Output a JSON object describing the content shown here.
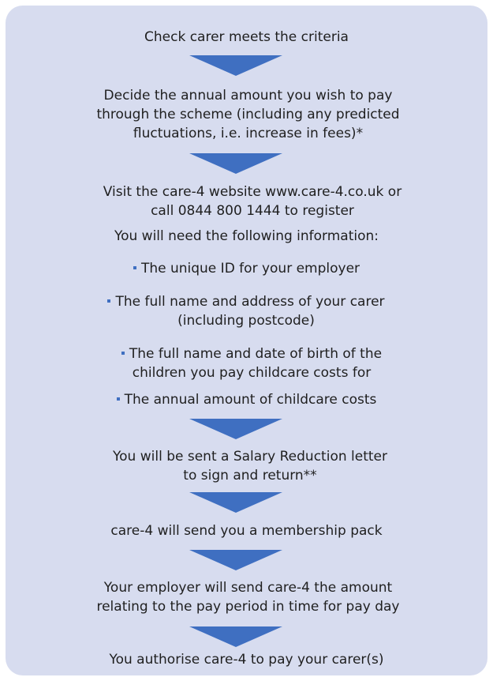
{
  "steps": [
    {
      "text": "Check carer meets the criteria"
    },
    {
      "text": "Decide the annual amount you wish to pay through the scheme (including any predicted fluctuations, i.e. increase in fees)*"
    },
    {
      "text": "Visit the care-4 website www.care-4.co.uk or call 0844 800 1444 to register"
    },
    {
      "text": "You will be sent a Salary Reduction letter to sign and return**"
    },
    {
      "text": "care-4 will send you a membership pack"
    },
    {
      "text": "Your employer will send care-4 the amount relating to the pay period in time for pay day"
    },
    {
      "text": "You authorise care-4 to pay your carer(s)"
    }
  ],
  "info": {
    "heading": "You will need the following information:",
    "items": [
      "The unique ID for your employer",
      "The full name and address of your carer (including postcode)",
      "The full name and date of birth of the children you pay childcare costs for",
      "The annual amount of childcare costs"
    ]
  },
  "colors": {
    "panel_background": "#d7dcef",
    "arrow": "#3f6fc1",
    "text": "#1f1f1f"
  }
}
